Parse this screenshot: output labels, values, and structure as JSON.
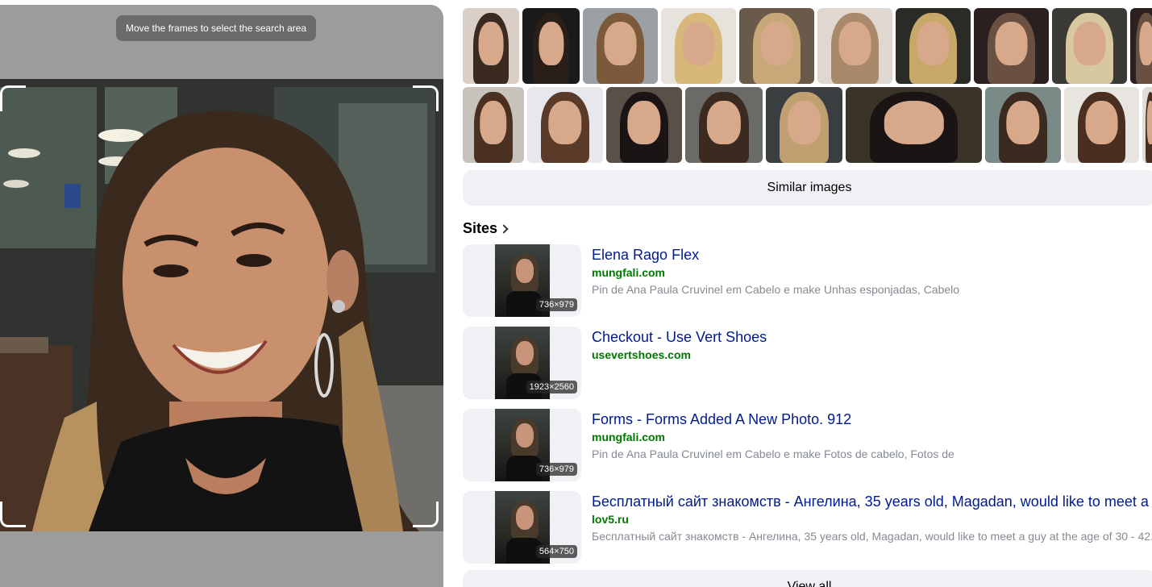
{
  "crop_panel": {
    "hint": "Move the frames to select the search area"
  },
  "thumb_rows": [
    [
      {
        "hair": "#3a2a20",
        "bg": "#d9cfc7",
        "width": 70
      },
      {
        "hair": "#2a1e18",
        "bg": "#1a1a1a",
        "width": 71
      },
      {
        "hair": "#7a5a3a",
        "bg": "#9aa0a4",
        "width": 93
      },
      {
        "hair": "#d8b878",
        "bg": "#e8e2dc",
        "width": 93
      },
      {
        "hair": "#c8a878",
        "bg": "#6a5a4a",
        "width": 93
      },
      {
        "hair": "#a88a6a",
        "bg": "#e0d8d0",
        "width": 93
      },
      {
        "hair": "#c8a868",
        "bg": "#2a2a26",
        "width": 93
      },
      {
        "hair": "#6a5040",
        "bg": "#2a2020",
        "width": 93
      },
      {
        "hair": "#d8c8a0",
        "bg": "#3a3a36",
        "width": 93
      },
      {
        "hair": "#6a5040",
        "bg": "#2a2020",
        "width": 40
      }
    ],
    [
      {
        "hair": "#4a3020",
        "bg": "#c8c2bc",
        "width": 76
      },
      {
        "hair": "#5a3a28",
        "bg": "#e8e8ec",
        "width": 94
      },
      {
        "hair": "#1a1414",
        "bg": "#5a5048",
        "width": 94
      },
      {
        "hair": "#3a2a20",
        "bg": "#6a6a66",
        "width": 96
      },
      {
        "hair": "#c0a070",
        "bg": "#3a3e40",
        "width": 95
      },
      {
        "hair": "#1a1414",
        "bg": "#3a3428",
        "width": 169
      },
      {
        "hair": "#3a2a20",
        "bg": "#7a8a86",
        "width": 94
      },
      {
        "hair": "#4a2e20",
        "bg": "#e8e4e0",
        "width": 93
      },
      {
        "hair": "#4a2e20",
        "bg": "#e0dcd8",
        "width": 20
      }
    ]
  ],
  "similar_button": "Similar images",
  "sites_heading": "Sites",
  "sites": [
    {
      "title": "Elena Rago Flex",
      "domain": "mungfali.com",
      "description": "Pin de Ana Paula Cruvinel em Cabelo e make Unhas esponjadas, Cabelo",
      "dims": "736×979"
    },
    {
      "title": "Checkout - Use Vert Shoes",
      "domain": "usevertshoes.com",
      "description": "",
      "dims": "1923×2560"
    },
    {
      "title": "Forms - Forms Added A New Photo. 912",
      "domain": "mungfali.com",
      "description": "Pin de Ana Paula Cruvinel em Cabelo e make Fotos de cabelo, Fotos de",
      "dims": "736×979"
    },
    {
      "title": "Бесплатный сайт знакомств - Ангелина, 35 years old, Magadan, would like to meet a",
      "domain": "lov5.ru",
      "description": "Бесплатный сайт знакомств - Ангелина, 35 years old, Magadan, would like to meet a guy at the age of 30 - 42.",
      "dims": "564×750"
    }
  ],
  "view_all_button": "View all"
}
